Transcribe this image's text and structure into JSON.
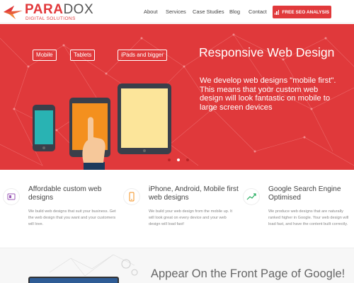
{
  "header": {
    "logo": {
      "name_part1": "PARA",
      "name_part2": "DOX",
      "tagline": "DIGITAL SOLUTIONS"
    },
    "nav": [
      "About",
      "Services",
      "Case Studies",
      "Blog",
      "Contact"
    ],
    "cta_label": "FREE SEO ANALYSIS",
    "cta_icon": "bar-chart-icon"
  },
  "hero": {
    "chips": [
      "Mobile",
      "Tablets",
      "iPads and bigger"
    ],
    "title": "Responsive Web Design",
    "text": "We develop web designs \"mobile first\". This means that your custom web design will look fantastic on mobile to large screen devices",
    "background_color": "#e0393b",
    "slides": 3,
    "active_slide": 2
  },
  "features": [
    {
      "icon": "palette-icon",
      "title": "Affordable custom web designs",
      "text": "We build web designs that suit your business. Get the web design that you want and your customers will love."
    },
    {
      "icon": "mobile-icon",
      "title": "iPhone, Android, Mobile first web designs",
      "text": "We build your web design from the mobile up. It will look great on every device and your web design will load fast!"
    },
    {
      "icon": "trend-chart-icon",
      "title": "Google Search Engine Optimised",
      "text": "We produce web designs that are naturally ranked higher in Google. Your web design will load fast, and have the content built correctly."
    }
  ],
  "bottom": {
    "title": "Appear On the Front Page of Google!"
  },
  "colors": {
    "accent": "#e1393b",
    "text": "#444444",
    "muted": "#888888"
  }
}
